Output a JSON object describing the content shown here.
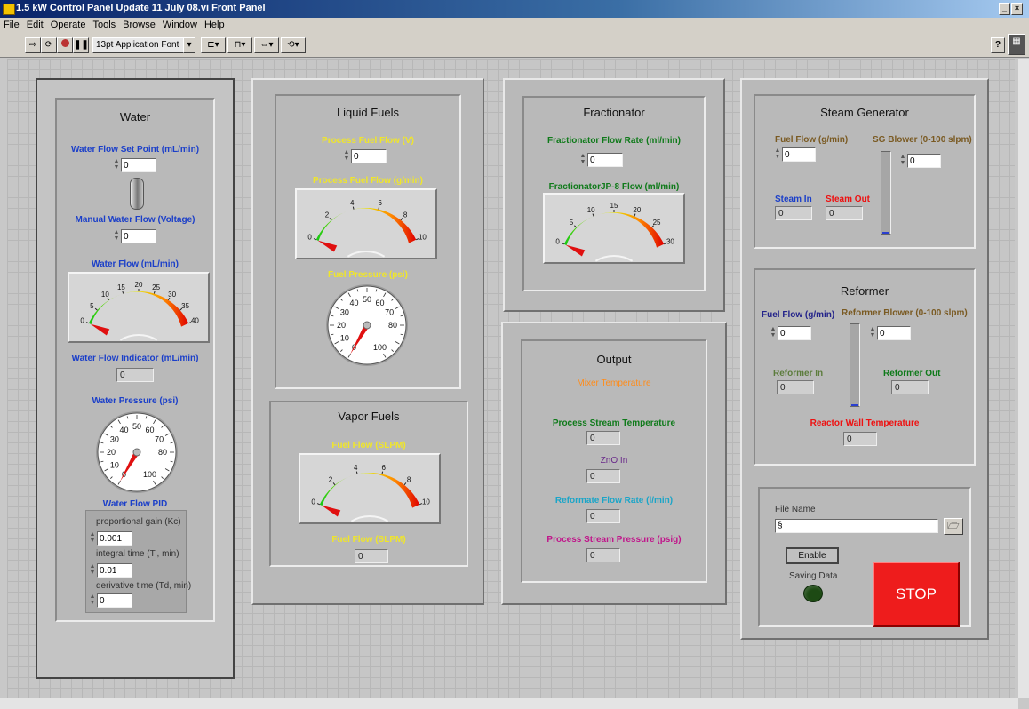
{
  "window": {
    "title": "1.5 kW Control Panel Update  11 July 08.vi Front Panel",
    "controls": [
      "_",
      "×"
    ]
  },
  "menu": [
    "File",
    "Edit",
    "Operate",
    "Tools",
    "Browse",
    "Window",
    "Help"
  ],
  "toolbar": {
    "font": "13pt Application Font",
    "help": "?"
  },
  "water": {
    "title": "Water",
    "setpoint_label": "Water Flow Set Point (mL/min)",
    "setpoint_value": "0",
    "manual_label": "Manual Water Flow (Voltage)",
    "manual_value": "0",
    "flow_gauge_label": "Water Flow (mL/min)",
    "flow_gauge_ticks": [
      "0",
      "5",
      "10",
      "15",
      "20",
      "25",
      "30",
      "35",
      "40"
    ],
    "indicator_label": "Water Flow Indicator (mL/min)",
    "indicator_value": "0",
    "pressure_label": "Water Pressure (psi)",
    "pressure_ticks": [
      "0",
      "10",
      "20",
      "30",
      "40",
      "50",
      "60",
      "70",
      "80",
      "100"
    ],
    "pid_label": "Water Flow PID",
    "kc_label": "proportional gain (Kc)",
    "kc_value": "0.001",
    "ti_label": "integral time (Ti, min)",
    "ti_value": "0.01",
    "td_label": "derivative time (Td, min)",
    "td_value": "0"
  },
  "liquid": {
    "title": "Liquid Fuels",
    "process_v_label": "Process Fuel Flow (V)",
    "process_v_value": "0",
    "gauge_label": "Process Fuel Flow (g/min)",
    "gauge_ticks": [
      "0",
      "2",
      "4",
      "6",
      "8",
      "10"
    ],
    "pressure_label": "Fuel Pressure (psi)",
    "pressure_ticks": [
      "0",
      "10",
      "20",
      "30",
      "40",
      "50",
      "60",
      "70",
      "80",
      "100"
    ]
  },
  "vapor": {
    "title": "Vapor Fuels",
    "gauge_label": "Fuel Flow (SLPM)",
    "gauge_ticks": [
      "0",
      "2",
      "4",
      "6",
      "8",
      "10"
    ],
    "ind_label": "Fuel Flow (SLPM)",
    "ind_value": "0"
  },
  "fractionator": {
    "title": "Fractionator",
    "rate_label": "Fractionator Flow Rate (ml/min)",
    "rate_value": "0",
    "gauge_label": "FractionatorJP-8 Flow (ml/min)",
    "gauge_ticks": [
      "0",
      "5",
      "10",
      "15",
      "20",
      "25",
      "30"
    ]
  },
  "output": {
    "title": "Output",
    "mixer_label": "Mixer Temperature",
    "stream_temp_label": "Process Stream Temperature",
    "stream_temp_value": "0",
    "zno_label": "ZnO In",
    "zno_value": "0",
    "reformate_label": "Reformate Flow Rate (l/min)",
    "reformate_value": "0",
    "pressure_label": "Process Stream Pressure (psig)",
    "pressure_value": "0"
  },
  "steam": {
    "title": "Steam Generator",
    "fuel_label": "Fuel Flow (g/min)",
    "fuel_value": "0",
    "blower_label": "SG Blower  (0-100 slpm)",
    "blower_value": "0",
    "in_label": "Steam In",
    "in_value": "0",
    "out_label": "Steam Out",
    "out_value": "0",
    "blower_level": 0
  },
  "reformer": {
    "title": "Reformer",
    "fuel_label": "Fuel Flow (g/min)",
    "fuel_value": "0",
    "blower_label": "Reformer Blower  (0-100 slpm)",
    "blower_value": "0",
    "in_label": "Reformer In",
    "in_value": "0",
    "out_label": "Reformer Out",
    "out_value": "0",
    "wall_label": "Reactor Wall Temperature",
    "wall_value": "0",
    "blower_level": 0
  },
  "file": {
    "name_label": "File Name",
    "path_prefix": "§",
    "enable_label": "Enable",
    "saving_label": "Saving Data",
    "stop_label": "STOP",
    "stop_color": "#ee1c1c",
    "led_color": "#1d4a14"
  },
  "gauge_values": {
    "water_flow": 0,
    "process_fuel": 0,
    "vapor_fuel": 0,
    "fractionator": 0,
    "water_pressure": 0,
    "fuel_pressure": 0
  }
}
